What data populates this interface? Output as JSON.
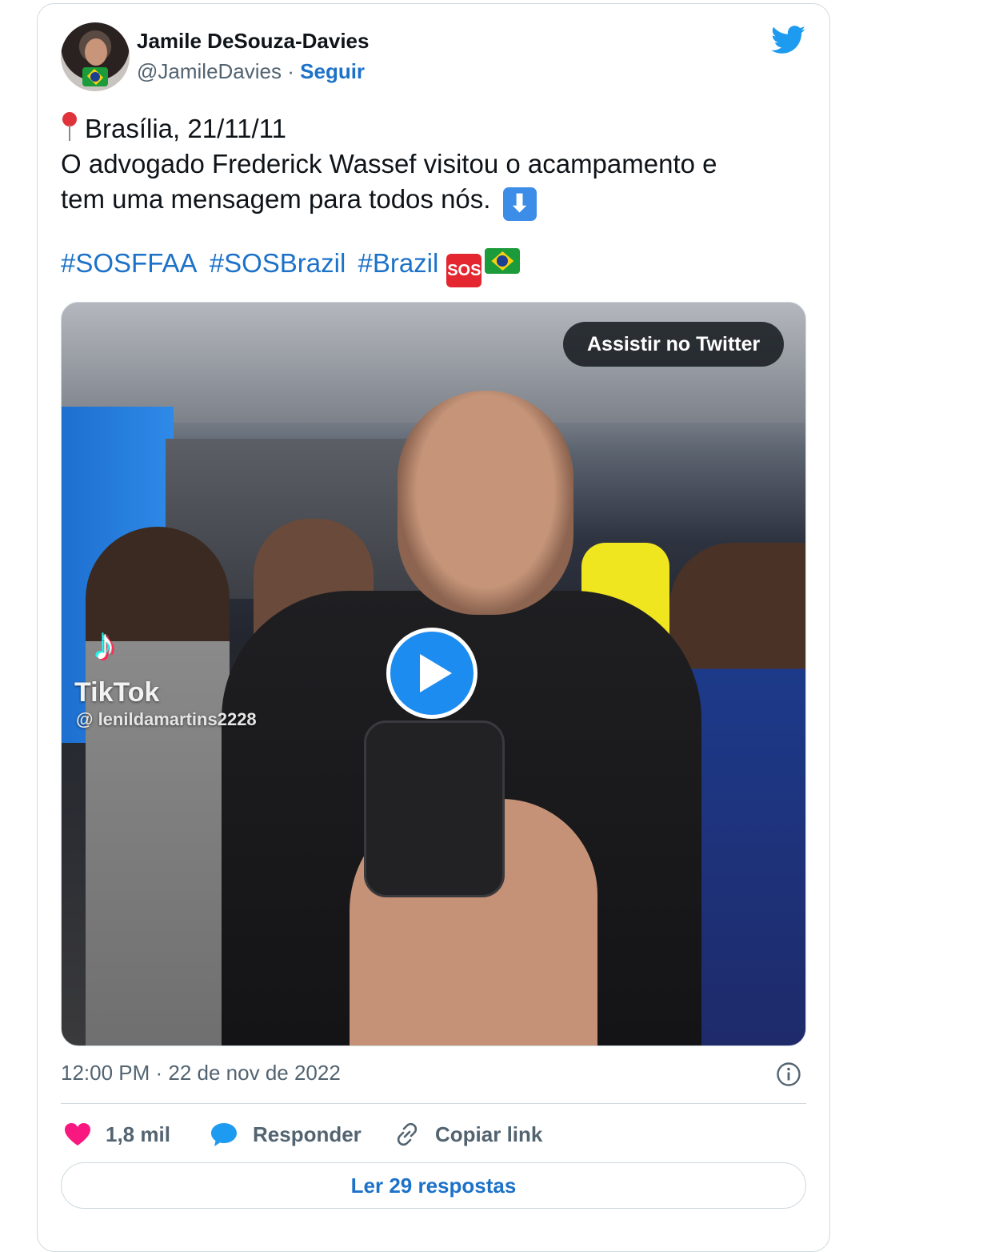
{
  "author": {
    "name": "Jamile DeSouza-Davies",
    "handle": "@JamileDavies",
    "separator": "·",
    "follow_label": "Seguir"
  },
  "tweet": {
    "line1": "Brasília, 21/11/11",
    "line2": "O advogado Frederick Wassef visitou o acampamento e",
    "line3": "tem uma mensagem para todos nós.",
    "down_arrow": "⬇",
    "hashtags": [
      "#SOSFFAA",
      "#SOSBrazil",
      "#Brazil"
    ],
    "sos_emoji": "SOS"
  },
  "media": {
    "watch_label": "Assistir no Twitter",
    "tiktok_label": "TikTok",
    "tiktok_user": "@ lenildamartins2228"
  },
  "meta": {
    "timestamp": "12:00 PM · 22 de nov de 2022"
  },
  "actions": {
    "likes": "1,8 mil",
    "reply_label": "Responder",
    "copy_link_label": "Copiar link"
  },
  "read_replies_label": "Ler 29 respostas",
  "colors": {
    "link_blue": "#1d72c8",
    "twitter_blue": "#1d9bf0",
    "heart_pink": "#f91880",
    "muted_text": "#536471"
  },
  "icons": [
    "twitter-bird-icon",
    "location-pin-icon",
    "down-arrow-icon",
    "sos-icon",
    "brazil-flag-icon",
    "play-icon",
    "info-icon",
    "heart-icon",
    "speech-bubble-icon",
    "link-icon"
  ]
}
